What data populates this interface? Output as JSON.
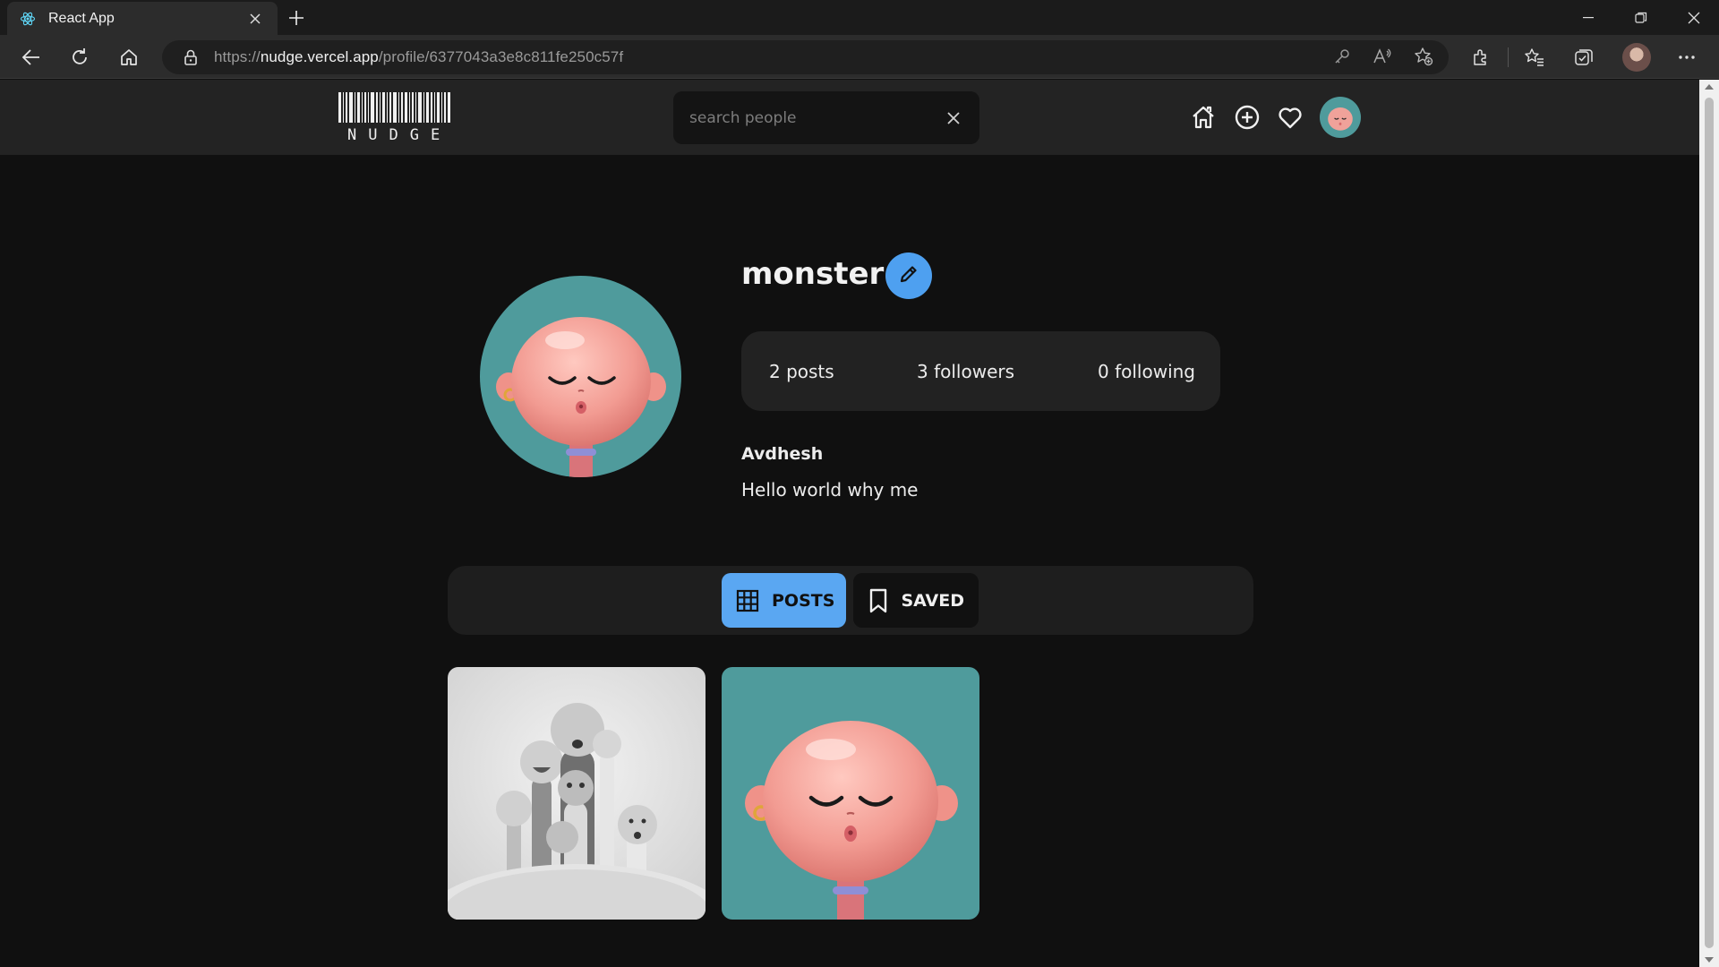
{
  "browser": {
    "tab_title": "React App",
    "url_scheme": "https://",
    "url_host": "nudge.vercel.app",
    "url_path": "/profile/6377043a3e8c811fe250c57f"
  },
  "header": {
    "logo_text": "NUDGE",
    "search_placeholder": "search people"
  },
  "profile": {
    "username": "monster",
    "stats": {
      "posts": "2 posts",
      "followers": "3 followers",
      "following": "0 following"
    },
    "full_name": "Avdhesh",
    "bio": "Hello world why me"
  },
  "tabs": [
    {
      "label": "POSTS",
      "icon": "grid-icon",
      "active": true
    },
    {
      "label": "SAVED",
      "icon": "bookmark-icon",
      "active": false
    }
  ],
  "posts": [
    {
      "name": "post-group-characters",
      "style": "grayscale 3D characters on grass"
    },
    {
      "name": "post-pink-character",
      "style": "pink 3D character on teal"
    }
  ],
  "colors": {
    "accent": "#4ea0f0",
    "avatar_bg": "#4f9b9c",
    "skin": "#f0a29a"
  }
}
